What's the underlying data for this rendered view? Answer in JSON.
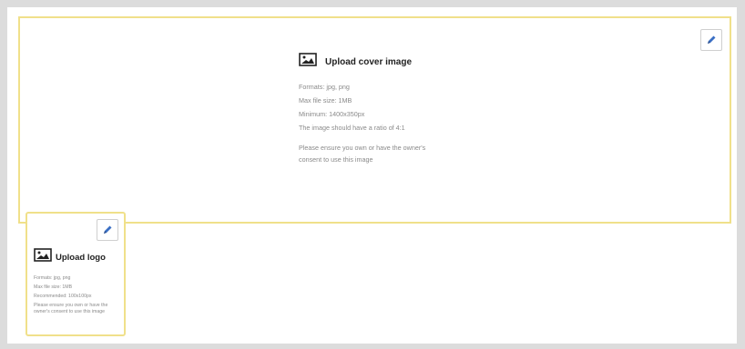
{
  "cover": {
    "title": "Upload cover image",
    "icon": "image-icon",
    "lines": [
      "Formats: jpg, png",
      "Max file size: 1MB",
      "Minimum: 1400x350px",
      "The image should have a ratio of 4:1"
    ],
    "consent": "Please ensure you own or have the owner's consent to use this image",
    "edit_icon": "pencil-icon"
  },
  "logo": {
    "title": "Upload logo",
    "icon": "image-icon",
    "lines": [
      "Formats: jpg, png",
      "Max file size: 1MB",
      "Recommended: 100x100px"
    ],
    "consent": "Please ensure you own or have the owner's consent to use this image",
    "edit_icon": "pencil-icon"
  },
  "colors": {
    "border_accent": "#f0e08a",
    "pencil_blue": "#3a6fc4",
    "text_muted": "#8a8a8a"
  }
}
